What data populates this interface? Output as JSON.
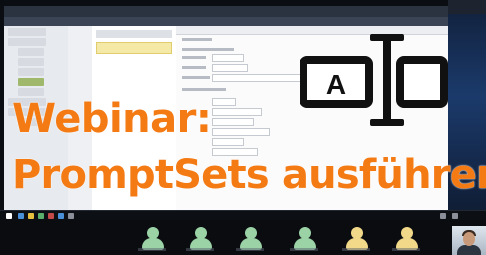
{
  "title": {
    "line1": "Webinar:",
    "line2": "PromptSets ausführen"
  },
  "colors": {
    "title": "#f47a14",
    "app_topbar": "#2b3340",
    "tree_selected": "#9fb86b",
    "highlight_row": "#f5e9a8",
    "meeting_icon": "#9bd2a6",
    "meeting_icon_alt": "#f2d98a"
  },
  "icon": {
    "name": "text-input-icon",
    "glyph": "A"
  },
  "meeting": {
    "participant_tiles": [
      "participant-1",
      "participant-2",
      "participant-3",
      "participant-4",
      "participant-5",
      "participant-6"
    ]
  }
}
